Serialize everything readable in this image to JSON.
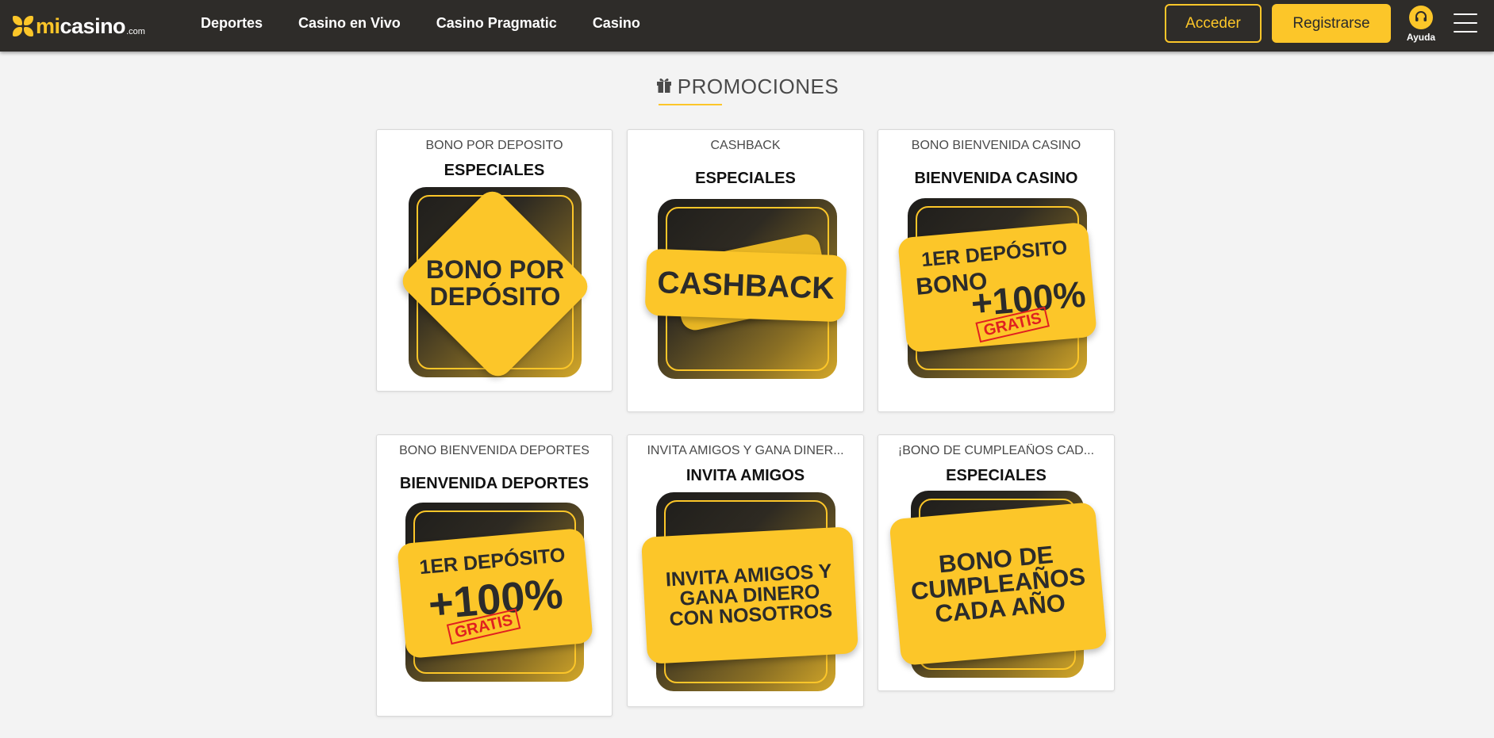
{
  "header": {
    "logo": {
      "mi": "mi",
      "casino": "casino",
      "com": ".com"
    },
    "nav": [
      {
        "label": "Deportes"
      },
      {
        "label": "Casino en Vivo"
      },
      {
        "label": "Casino Pragmatic"
      },
      {
        "label": "Casino"
      }
    ],
    "login_label": "Acceder",
    "register_label": "Registrarse",
    "help_label": "Ayuda",
    "help_icon": "headset-icon",
    "menu_icon": "hamburger-menu-icon"
  },
  "section": {
    "title": "PROMOCIONES",
    "icon": "gift-icon"
  },
  "colors": {
    "accent": "#fcc629",
    "header_bg": "#2e2c29",
    "page_bg": "#f3f3f3",
    "stamp_red": "#e02020"
  },
  "cards": [
    {
      "category": "BONO POR DEPOSITO",
      "title": "ESPECIALES",
      "art": {
        "line1": "BONO POR",
        "line2": "DEPÓSITO"
      }
    },
    {
      "category": "CASHBACK",
      "title": "ESPECIALES",
      "art": {
        "line1": "CASHBACK"
      }
    },
    {
      "category": "BONO BIENVENIDA CASINO",
      "title": "BIENVENIDA CASINO",
      "art": {
        "line1": "1ER DEPÓSITO",
        "line2": "BONO",
        "line3": "+100%",
        "stamp": "GRATIS"
      }
    },
    {
      "category": "BONO BIENVENIDA DEPORTES",
      "title": "BIENVENIDA DEPORTES",
      "art": {
        "line1": "1ER DEPÓSITO",
        "line2": "+100%",
        "stamp": "GRATIS"
      }
    },
    {
      "category": "INVITA AMIGOS Y GANA DINER...",
      "title": "INVITA AMIGOS",
      "art": {
        "line1": "INVITA AMIGOS Y",
        "line2": "GANA DINERO",
        "line3": "CON NOSOTROS"
      }
    },
    {
      "category": "¡BONO DE CUMPLEAÑOS CAD...",
      "title": "ESPECIALES",
      "art": {
        "line1": "BONO DE",
        "line2": "CUMPLEAÑOS",
        "line3": "CADA AÑO"
      }
    }
  ]
}
